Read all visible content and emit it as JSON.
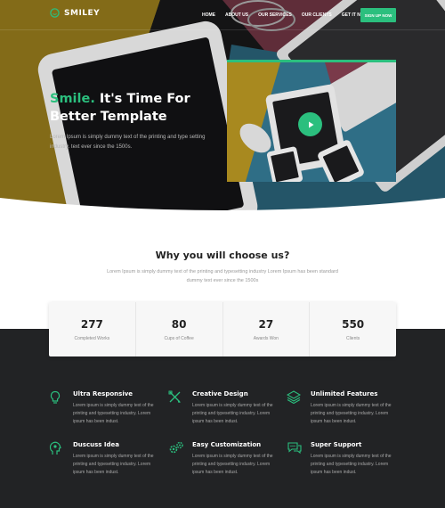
{
  "brand": {
    "name": "SMILEY",
    "accent": "#2bbf7e"
  },
  "nav": {
    "items": [
      "HOME",
      "ABOUT US",
      "OUR SERVICES",
      "OUR CLIENTS",
      "GET IT NOW"
    ],
    "signup": "SIGN UP NOW"
  },
  "hero": {
    "title_accent": "Smile.",
    "title_rest": "It's Time For Better Template",
    "subtitle": "Lorem Ipsum is simply dummy text of the printing and type setting industry. text ever since the 1500s."
  },
  "why": {
    "title": "Why you will choose us?",
    "subtitle": "Lorem Ipsum is simply dummy text of the printing and typesetting industry Lorem Ipsum has been standard dummy text ever since the 1500s"
  },
  "stats": [
    {
      "value": "277",
      "label": "Completed Works"
    },
    {
      "value": "80",
      "label": "Cups of Coffee"
    },
    {
      "value": "27",
      "label": "Awards Won"
    },
    {
      "value": "550",
      "label": "Clients"
    }
  ],
  "features": [
    {
      "title": "Ultra Responsive",
      "desc": "Lorem ipsum is simply dummy text of the printing and typesetting industry. Lorem ipsum has been indust.",
      "icon": "lightbulb-icon"
    },
    {
      "title": "Creative Design",
      "desc": "Lorem ipsum is simply dummy text of the printing and typesetting industry. Lorem ipsum has been indust.",
      "icon": "pencil-ruler-icon"
    },
    {
      "title": "Unlimited Features",
      "desc": "Lorem ipsum is simply dummy text of the printing and typesetting industry. Lorem ipsum has been indust.",
      "icon": "layers-icon"
    },
    {
      "title": "Duscuss Idea",
      "desc": "Lorem ipsum is simply dummy text of the printing and typesetting industry. Lorem ipsum has been indust.",
      "icon": "head-idea-icon"
    },
    {
      "title": "Easy Customization",
      "desc": "Lorem ipsum is simply dummy text of the printing and typesetting industry. Lorem ipsum has been indust.",
      "icon": "gears-icon"
    },
    {
      "title": "Super Support",
      "desc": "Lorem ipsum is simply dummy text of the printing and typesetting industry. Lorem ipsum has been indust.",
      "icon": "chat-bubbles-icon"
    }
  ]
}
